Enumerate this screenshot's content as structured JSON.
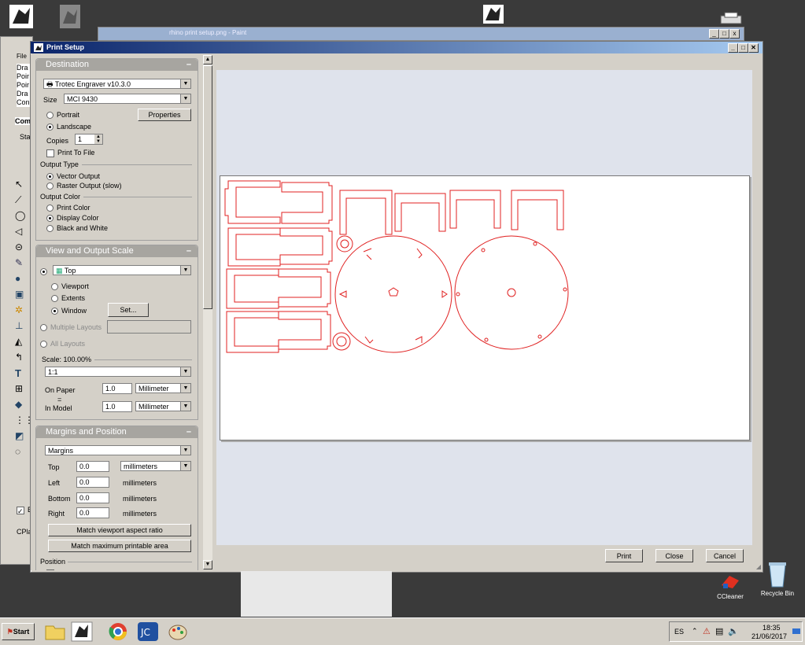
{
  "desktop": {
    "icons": [
      {
        "name": "rhino-icon",
        "label": ""
      },
      {
        "name": "rhino-gray-icon",
        "label": ""
      },
      {
        "name": "rhino-top-icon",
        "label": ""
      },
      {
        "name": "printer-desktop-icon",
        "label": ""
      },
      {
        "name": "ccleaner-icon",
        "label": "CCleaner"
      },
      {
        "name": "recycle-bin-icon",
        "label": "Recycle Bin"
      }
    ]
  },
  "background_window": {
    "title": "rhino print setup.png - Paint"
  },
  "rhino_sidebar": {
    "menu": "File",
    "items": [
      "Dra",
      "Poir",
      "Poir",
      "Dra",
      "Con"
    ],
    "command_label": "Com",
    "tab_label": "Sta",
    "cplane_label": "CPla",
    "check_label": "E"
  },
  "window": {
    "title": "Print Setup",
    "controls": {
      "minimize": "_",
      "maximize": "□",
      "close": "✕"
    }
  },
  "destination": {
    "header": "Destination",
    "collapse": "–",
    "printer": "Trotec Engraver v10.3.0",
    "size_label": "Size",
    "size_value": "MCI 9430",
    "portrait": "Portrait",
    "landscape": "Landscape",
    "properties": "Properties",
    "copies_label": "Copies",
    "copies_value": "1",
    "print_to_file": "Print To File",
    "output_type_label": "Output Type",
    "vector_output": "Vector Output",
    "raster_output": "Raster Output (slow)",
    "output_color_label": "Output Color",
    "print_color": "Print Color",
    "display_color": "Display Color",
    "black_white": "Black and White"
  },
  "view_scale": {
    "header": "View and Output Scale",
    "collapse": "–",
    "view_value": "Top",
    "viewport": "Viewport",
    "extents": "Extents",
    "window": "Window",
    "set_button": "Set...",
    "multiple_layouts": "Multiple Layouts",
    "all_layouts": "All Layouts",
    "scale_label": "Scale: 100.00%",
    "scale_value": "1:1",
    "on_paper_label": "On Paper",
    "on_paper_value": "1.0",
    "on_paper_unit": "Millimeter",
    "equals": "=",
    "in_model_label": "In Model",
    "in_model_value": "1.0",
    "in_model_unit": "Millimeter"
  },
  "margins": {
    "header": "Margins and Position",
    "collapse": "–",
    "mode": "Margins",
    "top_label": "Top",
    "top_value": "0.0",
    "top_unit": "millimeters",
    "left_label": "Left",
    "left_value": "0.0",
    "left_unit": "millimeters",
    "bottom_label": "Bottom",
    "bottom_value": "0.0",
    "bottom_unit": "millimeters",
    "right_label": "Right",
    "right_value": "0.0",
    "right_unit": "millimeters",
    "match_aspect": "Match viewport aspect ratio",
    "match_printable": "Match maximum printable area",
    "position_label": "Position"
  },
  "buttons": {
    "print": "Print",
    "close": "Close",
    "cancel": "Cancel"
  },
  "taskbar": {
    "start": "Start",
    "language": "ES",
    "time": "18:35",
    "date": "21/06/2017"
  },
  "colors": {
    "linework": "#e02020",
    "title_active": "#0a246a",
    "panel_header": "#a7a5a0"
  }
}
